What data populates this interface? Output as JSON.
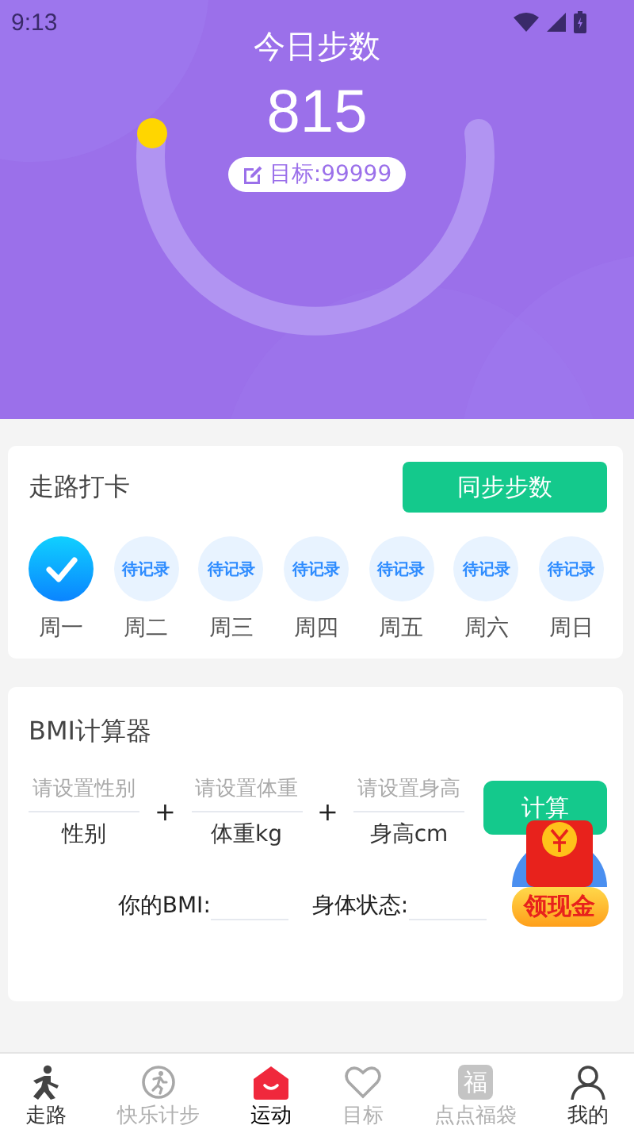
{
  "status_bar": {
    "time": "9:13"
  },
  "header": {
    "title": "今日步数",
    "steps": "815",
    "goal": "目标:99999"
  },
  "checkin": {
    "title": "走路打卡",
    "sync_button": "同步步数",
    "days": [
      {
        "label": "周一",
        "checked": true
      },
      {
        "label": "周二",
        "checked": false,
        "badge": "待记录"
      },
      {
        "label": "周三",
        "checked": false,
        "badge": "待记录"
      },
      {
        "label": "周四",
        "checked": false,
        "badge": "待记录"
      },
      {
        "label": "周五",
        "checked": false,
        "badge": "待记录"
      },
      {
        "label": "周六",
        "checked": false,
        "badge": "待记录"
      },
      {
        "label": "周日",
        "checked": false,
        "badge": "待记录"
      }
    ]
  },
  "bmi": {
    "title": "BMI计算器",
    "fields": [
      {
        "placeholder": "请设置性别",
        "label": "性别"
      },
      {
        "placeholder": "请设置体重",
        "label": "体重kg"
      },
      {
        "placeholder": "请设置身高",
        "label": "身高cm"
      }
    ],
    "operator": "+",
    "calc_button": "计算",
    "result_label": "你的BMI:",
    "status_label": "身体状态:"
  },
  "floating_reward": {
    "label": "领现金"
  },
  "tabs": [
    {
      "label": "走路",
      "selected": false,
      "dim": false
    },
    {
      "label": "快乐计步",
      "selected": false,
      "dim": true
    },
    {
      "label": "运动",
      "selected": true,
      "dim": false
    },
    {
      "label": "目标",
      "selected": false,
      "dim": true
    },
    {
      "label": "点点福袋",
      "selected": false,
      "dim": true,
      "glyph": "福"
    },
    {
      "label": "我的",
      "selected": false,
      "dim": false
    }
  ]
}
